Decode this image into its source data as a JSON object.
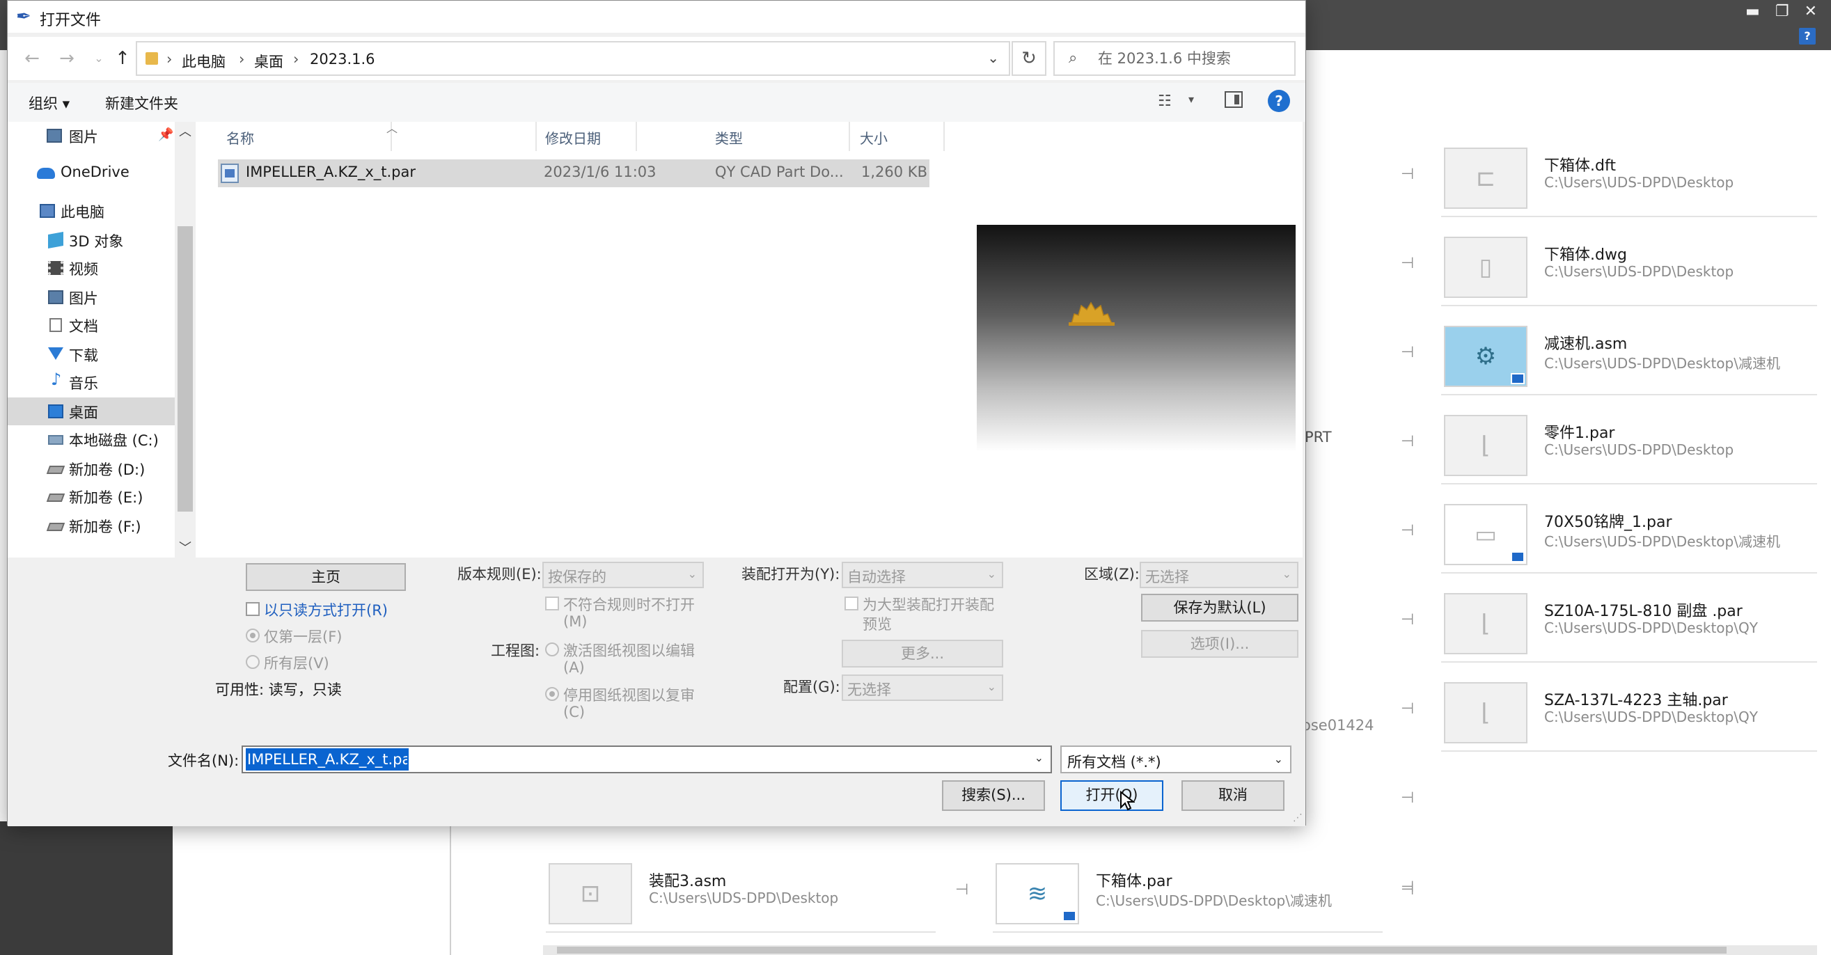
{
  "dialog": {
    "title": "打开文件",
    "breadcrumb": [
      "此电脑",
      "桌面",
      "2023.1.6"
    ],
    "search_placeholder": "在 2023.1.6 中搜索",
    "toolbar": {
      "organize": "组织 ▾",
      "new_folder": "新建文件夹"
    },
    "nav_items": [
      {
        "label": "图片"
      },
      {
        "label": "OneDrive"
      },
      {
        "label": "此电脑"
      },
      {
        "label": "3D 对象"
      },
      {
        "label": "视频"
      },
      {
        "label": "图片"
      },
      {
        "label": "文档"
      },
      {
        "label": "下载"
      },
      {
        "label": "音乐"
      },
      {
        "label": "桌面"
      },
      {
        "label": "本地磁盘 (C:)"
      },
      {
        "label": "新加卷 (D:)"
      },
      {
        "label": "新加卷 (E:)"
      },
      {
        "label": "新加卷 (F:)"
      }
    ],
    "columns": {
      "name": "名称",
      "date": "修改日期",
      "type": "类型",
      "size": "大小"
    },
    "files": [
      {
        "name": "IMPELLER_A.KZ_x_t.par",
        "date": "2023/1/6 11:03",
        "type": "QY CAD Part Do...",
        "size": "1,260 KB"
      }
    ],
    "options": {
      "home_button": "主页",
      "readonly_label": "以只读方式打开(R)",
      "first_layer": "仅第一层(F)",
      "all_layers": "所有层(V)",
      "availability": "可用性: 读写，只读",
      "version_rule_label": "版本规则(E):",
      "version_rule_value": "按保存的",
      "nonconform_line1": "不符合规则时不打开",
      "nonconform_line2": "(M)",
      "drawing_label": "工程图:",
      "activate_line1": "激活图纸视图以编辑",
      "activate_line2": "(A)",
      "deactivate_line1": "停用图纸视图以复审",
      "deactivate_line2": "(C)",
      "assembly_open_label": "装配打开为(Y):",
      "assembly_open_value": "自动选择",
      "large_asm_line1": "为大型装配打开装配",
      "large_asm_line2": "预览",
      "more_button": "更多...",
      "config_label": "配置(G):",
      "config_value": "无选择",
      "zone_label": "区域(Z):",
      "zone_value": "无选择",
      "save_default_button": "保存为默认(L)",
      "options_button": "选项(I)..."
    },
    "filename_label": "文件名(N):",
    "filename_value": "IMPELLER_A.KZ_x_t.par",
    "filter_value": "所有文档 (*.*)",
    "search_button": "搜索(S)...",
    "open_button": "打开(O)",
    "cancel_button": "取消"
  },
  "background": {
    "recent_files": [
      {
        "name": "下箱体.dft",
        "path": "C:\\Users\\UDS-DPD\\Desktop"
      },
      {
        "name": "下箱体.dwg",
        "path": "C:\\Users\\UDS-DPD\\Desktop"
      },
      {
        "name": "减速机.asm",
        "path": "C:\\Users\\UDS-DPD\\Desktop\\减速机"
      },
      {
        "name": "零件1.par",
        "path": "C:\\Users\\UDS-DPD\\Desktop"
      },
      {
        "name": "70X50铭牌_1.par",
        "path": "C:\\Users\\UDS-DPD\\Desktop\\减速机"
      },
      {
        "name": "SZ10A-175L-810 副盘 .par",
        "path": "C:\\Users\\UDS-DPD\\Desktop\\QY"
      },
      {
        "name": "SZA-137L-4223 主轴.par",
        "path": "C:\\Users\\UDS-DPD\\Desktop\\QY"
      }
    ],
    "bottom_files": [
      {
        "name": "装配3.asm",
        "path": "C:\\Users\\UDS-DPD\\Desktop"
      },
      {
        "name": "下箱体.par",
        "path": "C:\\Users\\UDS-DPD\\Desktop\\减速机"
      }
    ],
    "fragment_prt": "PRT",
    "fragment_ose": "ose01424"
  }
}
